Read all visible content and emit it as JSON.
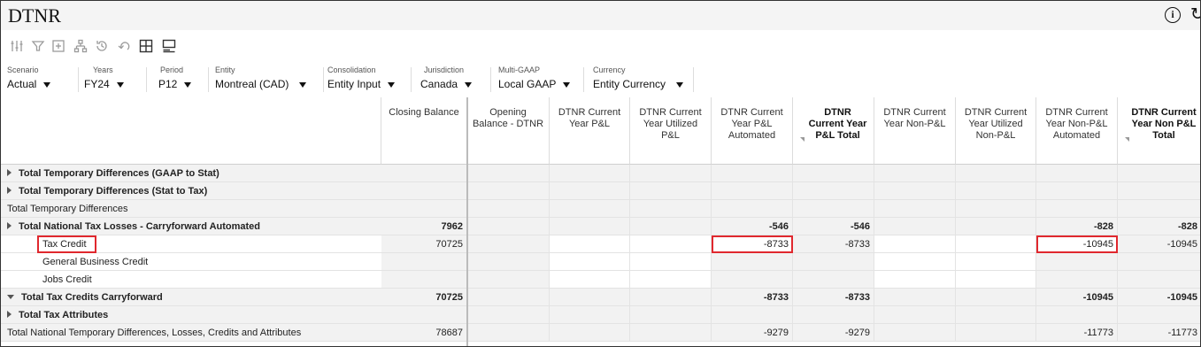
{
  "app": {
    "title": "DTNR"
  },
  "pov": [
    {
      "label": "Scenario",
      "value": "Actual"
    },
    {
      "label": "Years",
      "value": "FY24"
    },
    {
      "label": "Period",
      "value": "P12"
    },
    {
      "label": "Entity",
      "value": "Montreal (CAD)"
    },
    {
      "label": "Consolidation",
      "value": "Entity Input"
    },
    {
      "label": "Jurisdiction",
      "value": "Canada"
    },
    {
      "label": "Multi-GAAP",
      "value": "Local GAAP"
    },
    {
      "label": "Currency",
      "value": "Entity Currency"
    }
  ],
  "toolbar_icons": [
    "adjust-icon",
    "filter-icon",
    "add-icon",
    "hierarchy-icon",
    "history-icon",
    "undo-icon",
    "expand-grid-icon",
    "columns-icon"
  ],
  "columns": [
    {
      "label": "Closing Balance",
      "bold": false
    },
    {
      "label": "Opening Balance - DTNR",
      "bold": false
    },
    {
      "label": "DTNR Current Year P&L",
      "bold": false
    },
    {
      "label": "DTNR Current Year Utilized P&L",
      "bold": false
    },
    {
      "label": "DTNR Current Year P&L Automated",
      "bold": false
    },
    {
      "label": "DTNR Current Year P&L Total",
      "bold": true
    },
    {
      "label": "DTNR Current Year Non-P&L",
      "bold": false
    },
    {
      "label": "DTNR Current Year Utilized Non-P&L",
      "bold": false
    },
    {
      "label": "DTNR Current Year Non-P&L Automated",
      "bold": false
    },
    {
      "label": "DTNR Current Year Non P&L Total",
      "bold": true
    }
  ],
  "rows": [
    {
      "label": "Total Temporary Differences (GAAP to Stat)",
      "bold": true,
      "expander": "collapsed",
      "values": [
        "",
        "",
        "",
        "",
        "",
        "",
        "",
        "",
        "",
        ""
      ]
    },
    {
      "label": "Total Temporary Differences (Stat to Tax)",
      "bold": true,
      "expander": "collapsed",
      "values": [
        "",
        "",
        "",
        "",
        "",
        "",
        "",
        "",
        "",
        ""
      ]
    },
    {
      "label": "Total Temporary Differences",
      "bold": false,
      "expander": "none",
      "values": [
        "",
        "",
        "",
        "",
        "",
        "",
        "",
        "",
        "",
        ""
      ]
    },
    {
      "label": "Total National Tax Losses - Carryforward Automated",
      "bold": true,
      "expander": "collapsed",
      "values": [
        "7962",
        "",
        "",
        "",
        "-546",
        "-546",
        "",
        "",
        "-828",
        "-828"
      ]
    },
    {
      "label": "Tax Credit",
      "bold": false,
      "expander": "none",
      "child": true,
      "values": [
        "70725",
        "",
        "",
        "",
        "-8733",
        "-8733",
        "",
        "",
        "-10945",
        "-10945"
      ]
    },
    {
      "label": "General Business Credit",
      "bold": false,
      "expander": "none",
      "child": true,
      "values": [
        "",
        "",
        "",
        "",
        "",
        "",
        "",
        "",
        "",
        ""
      ]
    },
    {
      "label": "Jobs Credit",
      "bold": false,
      "expander": "none",
      "child": true,
      "values": [
        "",
        "",
        "",
        "",
        "",
        "",
        "",
        "",
        "",
        ""
      ]
    },
    {
      "label": "Total Tax Credits Carryforward",
      "bold": true,
      "expander": "expanded",
      "values": [
        "70725",
        "",
        "",
        "",
        "-8733",
        "-8733",
        "",
        "",
        "-10945",
        "-10945"
      ]
    },
    {
      "label": "Total Tax Attributes",
      "bold": true,
      "expander": "collapsed",
      "values": [
        "",
        "",
        "",
        "",
        "",
        "",
        "",
        "",
        "",
        ""
      ]
    },
    {
      "label": "Total National Temporary Differences, Losses, Credits and Attributes",
      "bold": false,
      "expander": "none",
      "values": [
        "78687",
        "",
        "",
        "",
        "-9279",
        "-9279",
        "",
        "",
        "-11773",
        "-11773"
      ]
    }
  ],
  "colors": {
    "highlight": "#e0282e"
  }
}
